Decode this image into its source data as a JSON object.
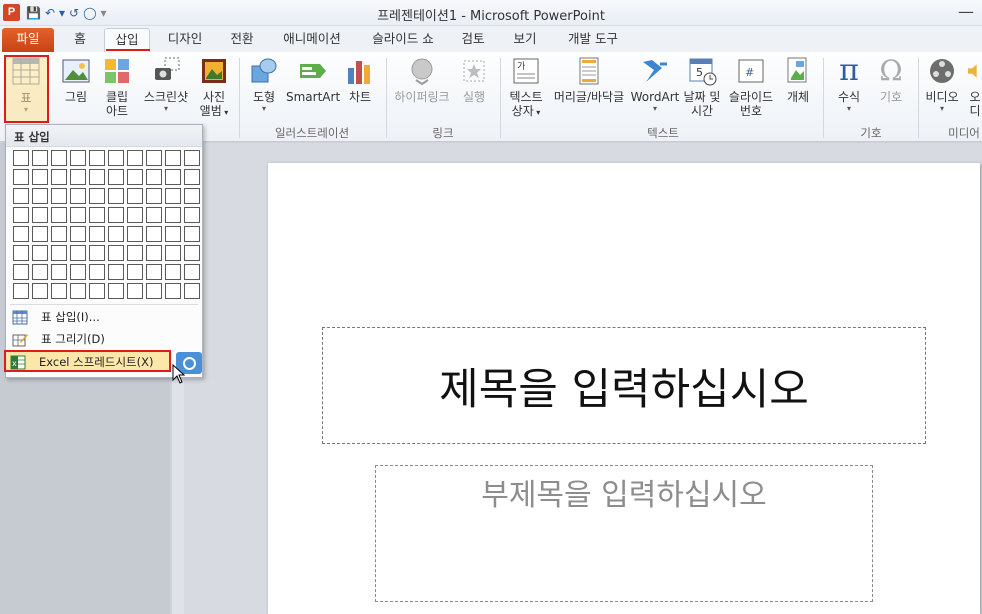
{
  "app": {
    "title": "프레젠테이션1  -  Microsoft PowerPoint",
    "icon_letter": "P"
  },
  "qat": {
    "save": "💾",
    "undo": "↶",
    "undo_caret": "▾",
    "redo": "↺",
    "ring": "◯",
    "more": "▾"
  },
  "tabs": [
    {
      "label": "파일",
      "kind": "file"
    },
    {
      "label": "홈"
    },
    {
      "label": "삽입",
      "active": true
    },
    {
      "label": "디자인"
    },
    {
      "label": "전환"
    },
    {
      "label": "애니메이션"
    },
    {
      "label": "슬라이드 쇼"
    },
    {
      "label": "검토"
    },
    {
      "label": "보기"
    },
    {
      "label": "개발 도구"
    }
  ],
  "ribbon": {
    "table": {
      "label": "표"
    },
    "picture": {
      "label": "그림"
    },
    "clipart": {
      "label1": "클립",
      "label2": "아트"
    },
    "screenshot": {
      "label": "스크린샷"
    },
    "album": {
      "label1": "사진",
      "label2": "앨범"
    },
    "shapes": {
      "label": "도형"
    },
    "smartart": {
      "label": "SmartArt"
    },
    "chart": {
      "label": "차트"
    },
    "hyperlink": {
      "label": "하이퍼링크"
    },
    "action": {
      "label": "실행"
    },
    "textbox": {
      "label1": "텍스트",
      "label2": "상자"
    },
    "headerfooter": {
      "label": "머리글/바닥글"
    },
    "wordart": {
      "label": "WordArt"
    },
    "datetime": {
      "label1": "날짜 및",
      "label2": "시간"
    },
    "slidenum": {
      "label1": "슬라이드",
      "label2": "번호"
    },
    "object": {
      "label": "개체"
    },
    "equation": {
      "label": "수식"
    },
    "symbol": {
      "label": "기호"
    },
    "video": {
      "label": "비디오"
    },
    "audio": {
      "label": "오디"
    },
    "groups": {
      "illustrations": "일러스트레이션",
      "links": "링크",
      "text": "텍스트",
      "symbols": "기호",
      "media": "미디어"
    }
  },
  "dropdown": {
    "header": "표 삽입",
    "grid_cols": 10,
    "grid_rows": 8,
    "items": [
      {
        "label": "표 삽입(I)...",
        "icon": "table-icon"
      },
      {
        "label": "표 그리기(D)",
        "icon": "pencil-table-icon"
      },
      {
        "label": "Excel 스프레드시트(X)",
        "icon": "excel-icon",
        "highlighted": true
      }
    ]
  },
  "slide": {
    "title_placeholder": "제목을 입력하십시오",
    "subtitle_placeholder": "부제목을 입력하십시오"
  },
  "colors": {
    "accent_red": "#e01b1b",
    "file_tab": "#d24726"
  }
}
